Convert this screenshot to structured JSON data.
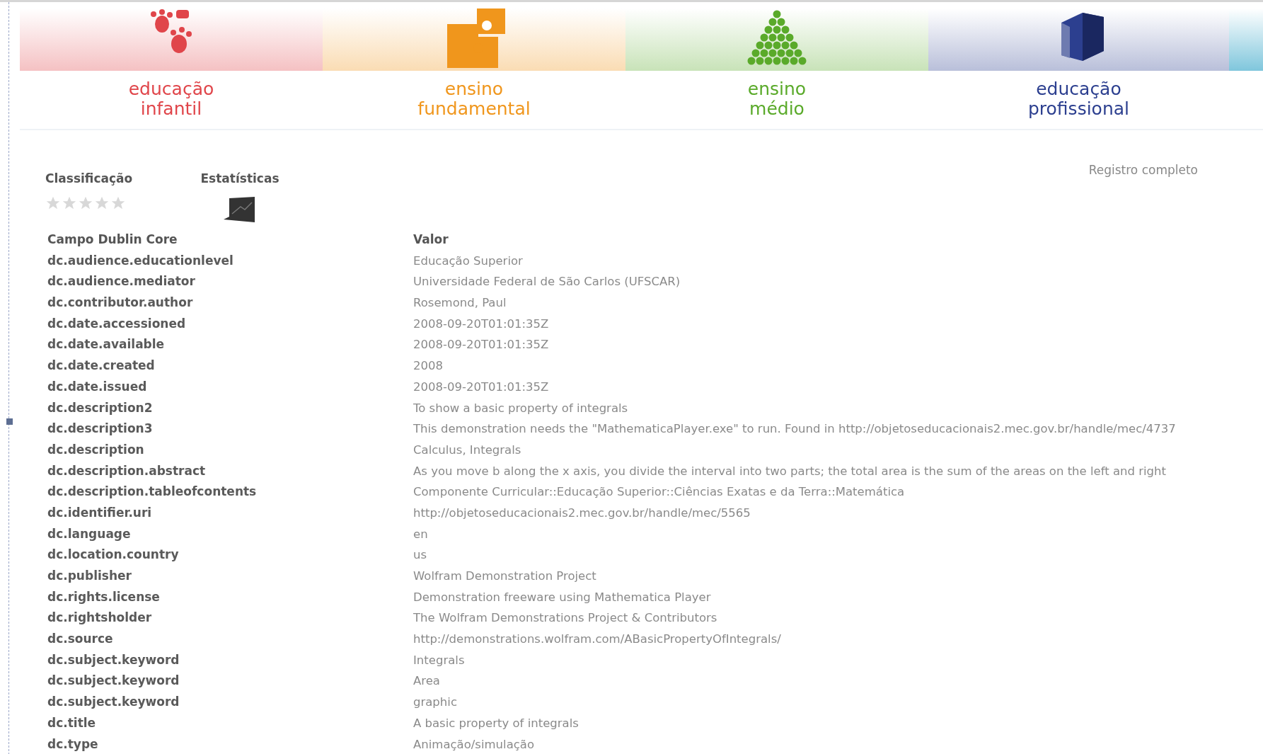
{
  "nav": [
    {
      "label": "educação infantil",
      "kind": "hands",
      "color": "#e0454a"
    },
    {
      "label": "ensino fundamental",
      "kind": "puzzle",
      "color": "#f0961c"
    },
    {
      "label": "ensino médio",
      "kind": "pyramid",
      "color": "#5aaa2a"
    },
    {
      "label": "educação profissional",
      "kind": "cube",
      "color": "#2c3f8f"
    },
    {
      "kind": "partial",
      "color": "#7fc6dc"
    }
  ],
  "rating": {
    "label": "Classificação",
    "stars": 0
  },
  "statistics": {
    "label": "Estatísticas"
  },
  "full_record_link": "Registro completo",
  "table": {
    "columns": [
      "Campo Dublin Core",
      "Valor"
    ],
    "rows": [
      [
        "dc.audience.educationlevel",
        "Educação Superior"
      ],
      [
        "dc.audience.mediator",
        "Universidade Federal de São Carlos (UFSCAR)"
      ],
      [
        "dc.contributor.author",
        "Rosemond, Paul"
      ],
      [
        "dc.date.accessioned",
        "2008-09-20T01:01:35Z"
      ],
      [
        "dc.date.available",
        "2008-09-20T01:01:35Z"
      ],
      [
        "dc.date.created",
        "2008"
      ],
      [
        "dc.date.issued",
        "2008-09-20T01:01:35Z"
      ],
      [
        "dc.description2",
        "To show a basic property of integrals"
      ],
      [
        "dc.description3",
        "This demonstration needs the \"MathematicaPlayer.exe\" to run. Found in http://objetoseducacionais2.mec.gov.br/handle/mec/4737"
      ],
      [
        "dc.description",
        "Calculus, Integrals"
      ],
      [
        "dc.description.abstract",
        "As you move b along the x axis, you divide the interval into two parts; the total area is the sum of the areas on the left and right"
      ],
      [
        "dc.description.tableofcontents",
        "Componente Curricular::Educação Superior::Ciências Exatas e da Terra::Matemática"
      ],
      [
        "dc.identifier.uri",
        "http://objetoseducacionais2.mec.gov.br/handle/mec/5565"
      ],
      [
        "dc.language",
        "en"
      ],
      [
        "dc.location.country",
        "us"
      ],
      [
        "dc.publisher",
        "Wolfram Demonstration Project"
      ],
      [
        "dc.rights.license",
        "Demonstration freeware using Mathematica Player"
      ],
      [
        "dc.rightsholder",
        "The Wolfram Demonstrations Project & Contributors"
      ],
      [
        "dc.source",
        "http://demonstrations.wolfram.com/ABasicPropertyOfIntegrals/"
      ],
      [
        "dc.subject.keyword",
        "Integrals"
      ],
      [
        "dc.subject.keyword",
        "Area"
      ],
      [
        "dc.subject.keyword",
        "graphic"
      ],
      [
        "dc.title",
        "A basic property of integrals"
      ],
      [
        "dc.type",
        "Animação/simulação"
      ]
    ]
  }
}
